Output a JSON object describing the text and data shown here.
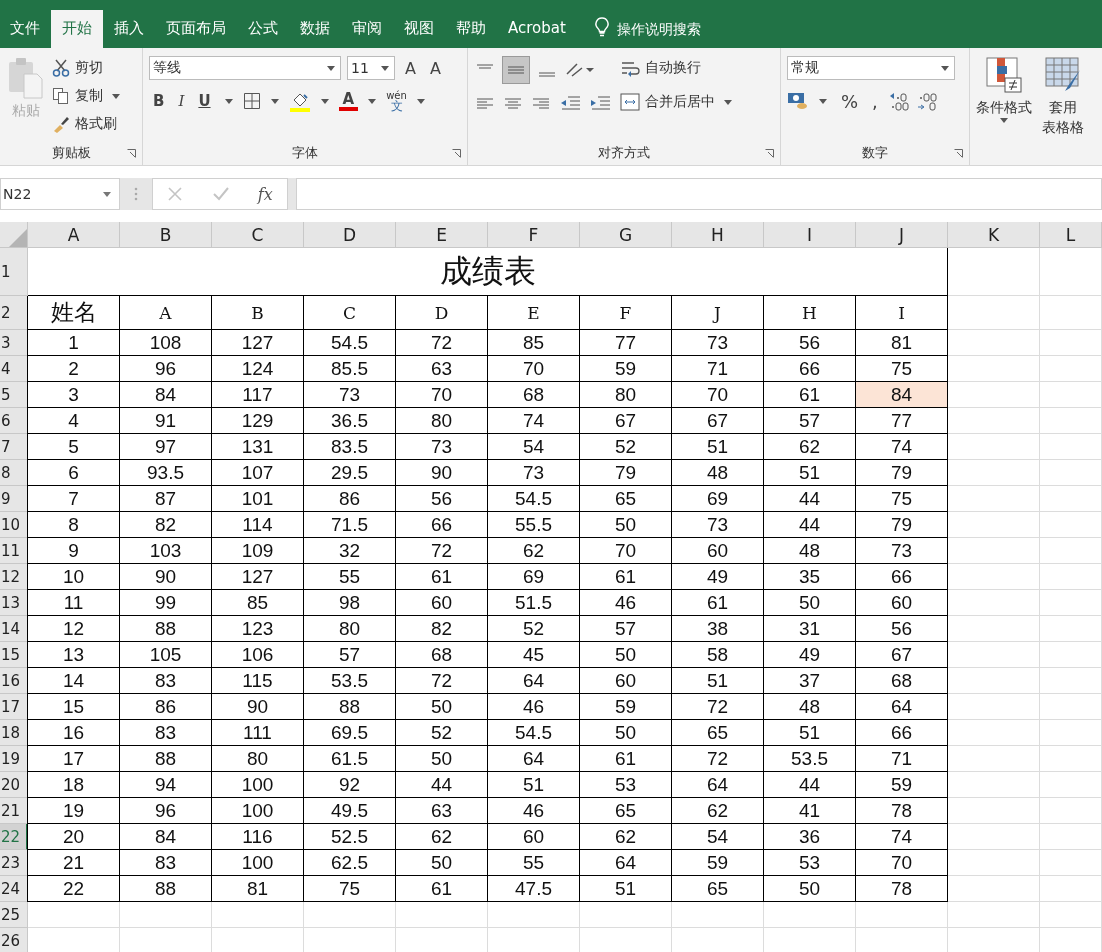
{
  "ribbon_tabs": [
    {
      "label": "文件",
      "selected": false
    },
    {
      "label": "开始",
      "selected": true
    },
    {
      "label": "插入",
      "selected": false
    },
    {
      "label": "页面布局",
      "selected": false
    },
    {
      "label": "公式",
      "selected": false
    },
    {
      "label": "数据",
      "selected": false
    },
    {
      "label": "审阅",
      "selected": false
    },
    {
      "label": "视图",
      "selected": false
    },
    {
      "label": "帮助",
      "selected": false
    },
    {
      "label": "Acrobat",
      "selected": false
    }
  ],
  "tell_me": "操作说明搜索",
  "clipboard": {
    "paste": "粘贴",
    "cut": "剪切",
    "copy": "复制",
    "format_painter": "格式刷",
    "label": "剪贴板"
  },
  "font": {
    "name": "等线",
    "size": "11",
    "grow": "A",
    "shrink": "A",
    "bold": "B",
    "italic": "I",
    "underline": "U",
    "font_color": "A",
    "phonetic_top": "wén",
    "phonetic_bottom": "文",
    "label": "字体"
  },
  "alignment": {
    "wrap_text": "自动换行",
    "merge_center": "合并后居中",
    "label": "对齐方式"
  },
  "number": {
    "format": "常规",
    "percent": "%",
    "comma": ",",
    "label": "数字"
  },
  "styles": {
    "conditional": "条件格式",
    "table_line1": "套用",
    "table_line2": "表格格"
  },
  "formula_bar": {
    "name_box": "N22",
    "fx": "fx"
  },
  "columns": [
    "A",
    "B",
    "C",
    "D",
    "E",
    "F",
    "G",
    "H",
    "I",
    "J",
    "K",
    "L"
  ],
  "title": "成绩表",
  "header_row": [
    "姓名",
    "A",
    "B",
    "C",
    "D",
    "E",
    "F",
    "J",
    "H",
    "I"
  ],
  "rows": [
    {
      "header": "3",
      "selected": false,
      "cells": [
        "1",
        "108",
        "127",
        "54.5",
        "72",
        "85",
        "77",
        "73",
        "56",
        "81"
      ]
    },
    {
      "header": "4",
      "selected": false,
      "cells": [
        "2",
        "96",
        "124",
        "85.5",
        "63",
        "70",
        "59",
        "71",
        "66",
        "75"
      ]
    },
    {
      "header": "5",
      "selected": false,
      "cells": [
        "3",
        "84",
        "117",
        "73",
        "70",
        "68",
        "80",
        "70",
        "61",
        {
          "text": "84",
          "highlighted": true
        }
      ]
    },
    {
      "header": "6",
      "selected": false,
      "cells": [
        "4",
        "91",
        "129",
        "36.5",
        "80",
        "74",
        "67",
        "67",
        "57",
        "77"
      ]
    },
    {
      "header": "7",
      "selected": false,
      "cells": [
        "5",
        "97",
        "131",
        "83.5",
        "73",
        "54",
        "52",
        "51",
        "62",
        "74"
      ]
    },
    {
      "header": "8",
      "selected": false,
      "cells": [
        "6",
        "93.5",
        "107",
        "29.5",
        "90",
        "73",
        "79",
        "48",
        "51",
        "79"
      ]
    },
    {
      "header": "9",
      "selected": false,
      "cells": [
        "7",
        "87",
        "101",
        "86",
        "56",
        "54.5",
        "65",
        "69",
        "44",
        "75"
      ]
    },
    {
      "header": "10",
      "selected": false,
      "cells": [
        "8",
        "82",
        "114",
        "71.5",
        "66",
        "55.5",
        "50",
        "73",
        "44",
        "79"
      ]
    },
    {
      "header": "11",
      "selected": false,
      "cells": [
        "9",
        "103",
        "109",
        "32",
        "72",
        "62",
        "70",
        "60",
        "48",
        "73"
      ]
    },
    {
      "header": "12",
      "selected": false,
      "cells": [
        "10",
        "90",
        "127",
        "55",
        "61",
        "69",
        "61",
        "49",
        "35",
        "66"
      ]
    },
    {
      "header": "13",
      "selected": false,
      "cells": [
        "11",
        "99",
        "85",
        "98",
        "60",
        "51.5",
        "46",
        "61",
        "50",
        "60"
      ]
    },
    {
      "header": "14",
      "selected": false,
      "cells": [
        "12",
        "88",
        "123",
        "80",
        "82",
        "52",
        "57",
        "38",
        "31",
        "56"
      ]
    },
    {
      "header": "15",
      "selected": false,
      "cells": [
        "13",
        "105",
        "106",
        "57",
        "68",
        "45",
        "50",
        "58",
        "49",
        "67"
      ]
    },
    {
      "header": "16",
      "selected": false,
      "cells": [
        "14",
        "83",
        "115",
        "53.5",
        "72",
        "64",
        "60",
        "51",
        "37",
        "68"
      ]
    },
    {
      "header": "17",
      "selected": false,
      "cells": [
        "15",
        "86",
        "90",
        "88",
        "50",
        "46",
        "59",
        "72",
        "48",
        "64"
      ]
    },
    {
      "header": "18",
      "selected": false,
      "cells": [
        "16",
        "83",
        "111",
        "69.5",
        "52",
        "54.5",
        "50",
        "65",
        "51",
        "66"
      ]
    },
    {
      "header": "19",
      "selected": false,
      "cells": [
        "17",
        "88",
        "80",
        "61.5",
        "50",
        "64",
        "61",
        "72",
        "53.5",
        "71"
      ]
    },
    {
      "header": "20",
      "selected": false,
      "cells": [
        "18",
        "94",
        "100",
        "92",
        "44",
        "51",
        "53",
        "64",
        "44",
        "59"
      ]
    },
    {
      "header": "21",
      "selected": false,
      "cells": [
        "19",
        "96",
        "100",
        "49.5",
        "63",
        "46",
        "65",
        "62",
        "41",
        "78"
      ]
    },
    {
      "header": "22",
      "selected": true,
      "cells": [
        "20",
        "84",
        "116",
        "52.5",
        "62",
        "60",
        "62",
        "54",
        "36",
        "74"
      ]
    },
    {
      "header": "23",
      "selected": false,
      "cells": [
        "21",
        "83",
        "100",
        "62.5",
        "50",
        "55",
        "64",
        "59",
        "53",
        "70"
      ]
    },
    {
      "header": "24",
      "selected": false,
      "cells": [
        "22",
        "88",
        "81",
        "75",
        "61",
        "47.5",
        "51",
        "65",
        "50",
        "78"
      ]
    }
  ],
  "row_headers_top": [
    {
      "label": "1",
      "selected": false
    },
    {
      "label": "2",
      "selected": false
    }
  ],
  "row_headers_bottom": [
    {
      "label": "25",
      "selected": false
    },
    {
      "label": "26",
      "selected": false
    }
  ]
}
